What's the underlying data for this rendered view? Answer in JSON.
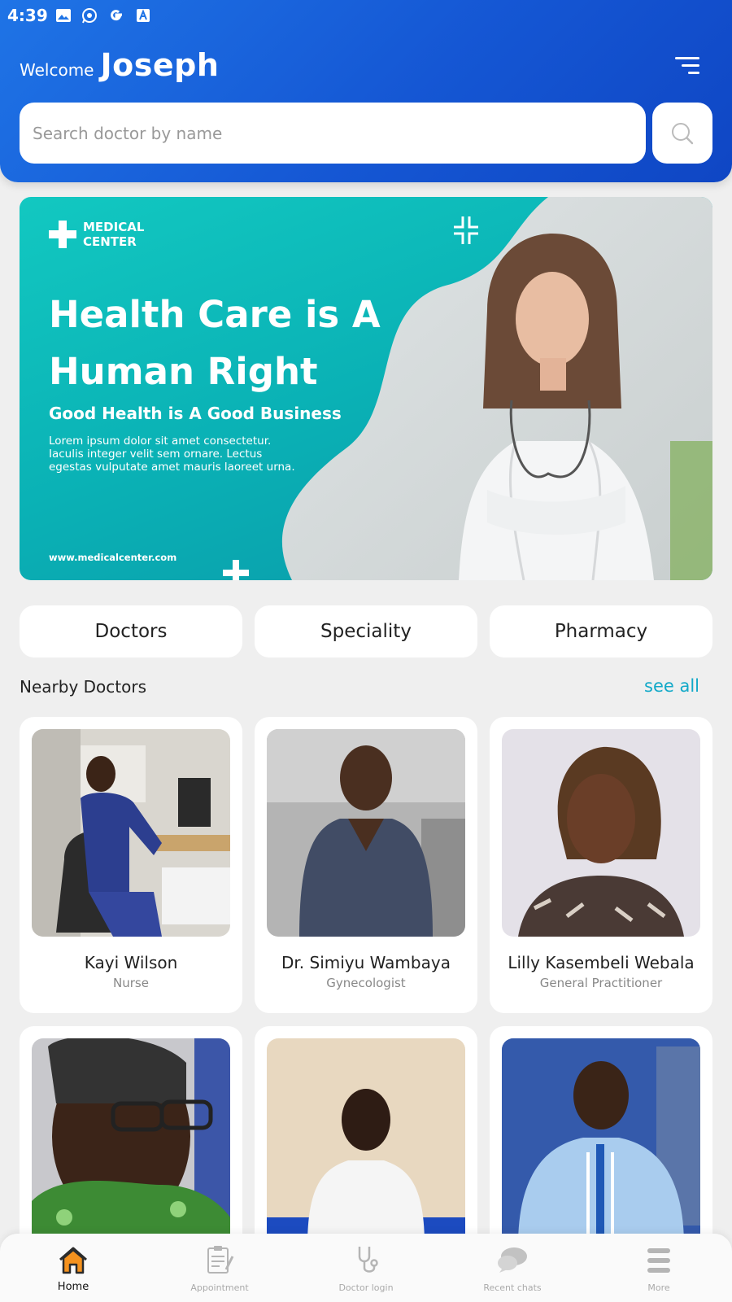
{
  "status_bar": {
    "time": "4:39",
    "icons": [
      "gallery-icon",
      "whatsapp-icon",
      "google-icon",
      "translate-icon"
    ]
  },
  "header": {
    "welcome_label": "Welcome",
    "user_name": "Joseph",
    "menu_icon": "filter-menu-icon",
    "gradient_colors": [
      "#1f74e6",
      "#0f46c4"
    ]
  },
  "search": {
    "placeholder": "Search doctor by name",
    "value": "",
    "button_icon": "search-icon"
  },
  "banner": {
    "brand": "MEDICAL CENTER",
    "title": "Health Care is A Human Right",
    "subtitle": "Good Health is A Good Business",
    "body": "Lorem ipsum dolor sit amet consectetur. Iaculis integer velit sem ornare. Lectus egestas vulputate amet mauris laoreet urna.",
    "url": "www.medicalcenter.com",
    "accent_color": "#12c8c1"
  },
  "categories": [
    {
      "label": "Doctors"
    },
    {
      "label": "Speciality"
    },
    {
      "label": "Pharmacy"
    }
  ],
  "nearby": {
    "title": "Nearby Doctors",
    "see_all": "see all",
    "see_all_color": "#12a9c8",
    "doctors": [
      {
        "name": "Kayi Wilson",
        "role": "Nurse"
      },
      {
        "name": "Dr. Simiyu Wambaya",
        "role": "Gynecologist"
      },
      {
        "name": "Lilly Kasembeli Webala",
        "role": "General Practitioner"
      },
      {
        "name": "",
        "role": ""
      },
      {
        "name": "",
        "role": ""
      },
      {
        "name": "",
        "role": ""
      }
    ]
  },
  "bottom_nav": {
    "items": [
      {
        "label": "Home",
        "icon": "home-icon",
        "active": true
      },
      {
        "label": "Appointment",
        "icon": "appointment-icon",
        "active": false
      },
      {
        "label": "Doctor login",
        "icon": "stethoscope-icon",
        "active": false
      },
      {
        "label": "Recent chats",
        "icon": "chat-icon",
        "active": false
      },
      {
        "label": "More",
        "icon": "more-menu-icon",
        "active": false
      }
    ],
    "active_color": "#f5921e"
  }
}
